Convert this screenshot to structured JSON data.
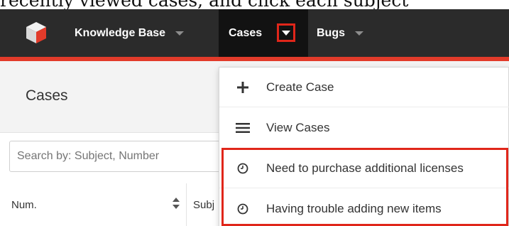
{
  "caption": "recently viewed cases, and click each subject",
  "navbar": {
    "items": [
      {
        "label": "Knowledge Base"
      },
      {
        "label": "Cases"
      },
      {
        "label": "Bugs"
      }
    ]
  },
  "panel": {
    "title": "Cases",
    "search_placeholder": "Search by: Subject, Number"
  },
  "table": {
    "columns": [
      "Num.",
      "Subj"
    ]
  },
  "menu": {
    "items": [
      {
        "label": "Create Case",
        "icon": "plus-icon"
      },
      {
        "label": "View Cases",
        "icon": "list-icon"
      },
      {
        "label": "Need to purchase additional licenses",
        "icon": "clock-icon"
      },
      {
        "label": "Having trouble adding new items",
        "icon": "clock-icon"
      }
    ]
  },
  "colors": {
    "navbar_bg": "#2b2b2b",
    "active_tab_bg": "#121212",
    "accent_red": "#e23b2a",
    "highlight_red": "#e0261a"
  }
}
